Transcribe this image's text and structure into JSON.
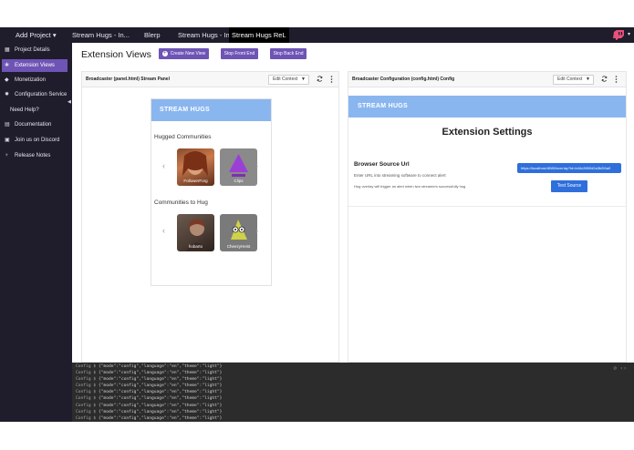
{
  "topbar": {
    "add_project": "Add Project",
    "add_project_caret": "▾",
    "tabs": [
      {
        "label": "Stream Hugs - In..."
      },
      {
        "label": "Blerp"
      },
      {
        "label": "Stream Hugs - In..."
      },
      {
        "label": "Stream Hugs ReL"
      }
    ],
    "logo_icon": "twitch-glitch-icon",
    "logo_color": "#e9507a"
  },
  "sidebar": {
    "items": [
      {
        "label": "Project Details",
        "icon": "grid-icon",
        "glyph": "▦"
      },
      {
        "label": "Extension Views",
        "icon": "puzzle-icon",
        "glyph": "✱",
        "active": true
      },
      {
        "label": "Monetization",
        "icon": "diamond-icon",
        "glyph": "◆"
      },
      {
        "label": "Configuration Service",
        "icon": "gear-icon",
        "glyph": "✹"
      },
      {
        "label": "Need Help?"
      },
      {
        "label": "Documentation",
        "icon": "document-icon",
        "glyph": "▤"
      },
      {
        "label": "Join us on Discord",
        "icon": "chat-icon",
        "glyph": "▣"
      },
      {
        "label": "Release Notes",
        "icon": "notes-icon",
        "glyph": "♆"
      }
    ],
    "collapse_glyph": "◀"
  },
  "main": {
    "title": "Extension Views",
    "create_view": "Create New View",
    "create_plus": "+",
    "stop_front_end": "Stop Front End",
    "stop_back_end": "Stop Back End"
  },
  "left_panel": {
    "title": "Broadcaster (panel.html) Stream Panel",
    "context": "Edit Context",
    "app_header": "STREAM HUGS",
    "hugged_label": "Hugged Communities",
    "hugged": [
      {
        "label": "FollowerForg"
      },
      {
        "label": "Clips"
      }
    ],
    "to_hug_label": "Communities to Hug",
    "to_hug": [
      {
        "label": "hobarto"
      },
      {
        "label": "CheezyHeist"
      }
    ],
    "arrow_left": "‹",
    "arrow_right": "›"
  },
  "right_panel": {
    "title": "Broadcaster Configuration (config.html) Config",
    "context": "Edit Context",
    "app_header": "STREAM HUGS",
    "settings_title": "Extension Settings",
    "browser_source": "Browser Source Url",
    "enter_url": "Enter URL into streaming software to connect alert",
    "hug_overlay": "Hug overlay will trigger an alert when two streamers successfully hug",
    "url_value": "https://localhost:8080/overlay?id=b44c2f8f2d2a3b2f4a0",
    "test_source": "Test Source"
  },
  "console": {
    "prefix": "Config $",
    "lines": [
      "{\"mode\":\"config\",\"language\":\"en\",\"theme\":\"light\"}",
      "{\"mode\":\"config\",\"language\":\"en\",\"theme\":\"light\"}",
      "{\"mode\":\"config\",\"language\":\"en\",\"theme\":\"light\"}",
      "{\"mode\":\"config\",\"language\":\"en\",\"theme\":\"light\"}",
      "{\"mode\":\"config\",\"language\":\"en\",\"theme\":\"light\"}",
      "{\"mode\":\"config\",\"language\":\"en\",\"theme\":\"light\"}",
      "{\"mode\":\"config\",\"language\":\"en\",\"theme\":\"light\"}",
      "{\"mode\":\"config\",\"language\":\"en\",\"theme\":\"light\"}",
      "{\"mode\":\"config\",\"language\":\"en\",\"theme\":\"light\"}"
    ],
    "controls": "⊘ ‹›"
  }
}
